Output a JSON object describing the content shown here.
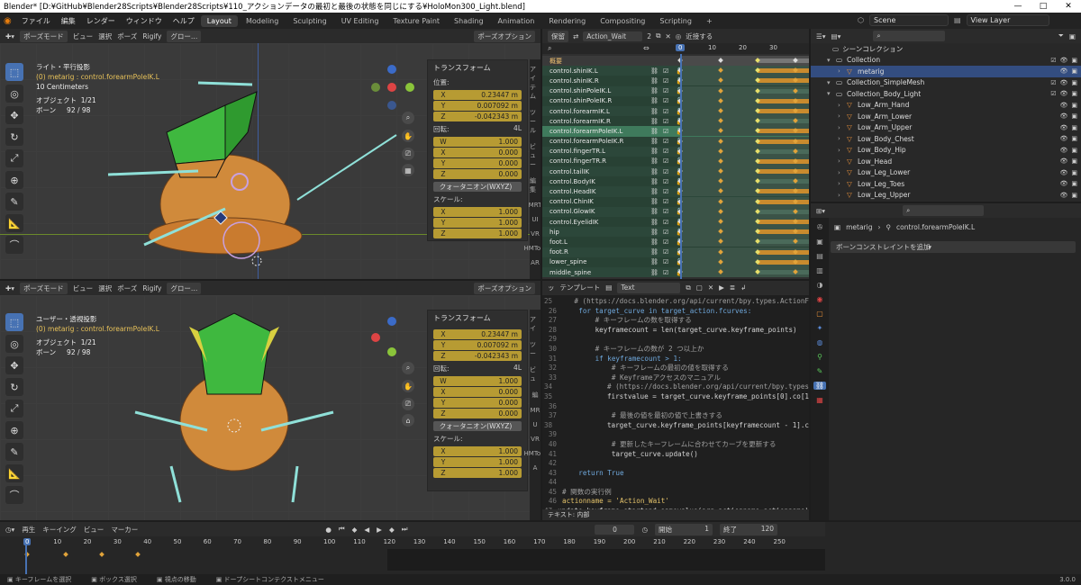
{
  "window": {
    "title": "Blender* [D:¥GitHub¥Blender28Scripts¥Blender28Scripts¥110_アクションデータの最初と最後の状態を同じにする¥HoloMon300_Light.blend]",
    "controls": [
      "—",
      "□",
      "✕"
    ]
  },
  "menu": {
    "items": [
      "ファイル",
      "編集",
      "レンダー",
      "ウィンドウ",
      "ヘルプ"
    ],
    "workspaces": [
      "Layout",
      "Modeling",
      "Sculpting",
      "UV Editing",
      "Texture Paint",
      "Shading",
      "Animation",
      "Rendering",
      "Compositing",
      "Scripting",
      "+"
    ],
    "active_workspace": "Layout",
    "scene": "Scene",
    "view_layer": "View Layer"
  },
  "viewport_top": {
    "header": [
      "ポーズモード",
      "ビュー",
      "選択",
      "ポーズ",
      "Rigify",
      "グロー…"
    ],
    "view_name": "ライト・平行投影",
    "sub": "(0) metarig : control.forearmPoleIK.L",
    "scale": "10 Centimeters",
    "objects_label": "オブジェクト",
    "objects_value": "1/21",
    "bones_label": "ボーン",
    "bones_value": "92 / 98",
    "options": "ポーズオプション"
  },
  "viewport_bottom": {
    "header": [
      "ポーズモード",
      "ビュー",
      "選択",
      "ポーズ",
      "Rigify",
      "グロー…"
    ],
    "view_name": "ユーザー・透視投影",
    "sub": "(0) metarig : control.forearmPoleIK.L",
    "objects_label": "オブジェクト",
    "objects_value": "1/21",
    "bones_label": "ボーン",
    "bones_value": "92 / 98",
    "options": "ポーズオプション"
  },
  "transform": {
    "title": "トランスフォーム",
    "location_label": "位置:",
    "location": [
      [
        "X",
        "0.23447 m"
      ],
      [
        "Y",
        "0.007092 m"
      ],
      [
        "Z",
        "-0.042343 m"
      ]
    ],
    "rotation_label": "回転:",
    "rotation_mode_badge": "4L",
    "rotation": [
      [
        "W",
        "1.000"
      ],
      [
        "X",
        "0.000"
      ],
      [
        "Y",
        "0.000"
      ],
      [
        "Z",
        "0.000"
      ]
    ],
    "rotation_mode": "クォータニオン(WXYZ)",
    "scale_label": "スケール:",
    "scale": [
      [
        "X",
        "1.000"
      ],
      [
        "Y",
        "1.000"
      ],
      [
        "Z",
        "1.000"
      ]
    ]
  },
  "npanel_tabs": [
    "アイテム",
    "ツール",
    "ビュー",
    "編集",
    "MRT",
    "UI",
    "VR",
    "HMTool",
    "AR"
  ],
  "npanel_tabs_bottom": [
    "アイ",
    "ツー",
    "ビュ",
    "編",
    "MR",
    "U",
    "VR",
    "HMTool",
    "A"
  ],
  "dopesheet": {
    "mode": "保留",
    "action": "Action_Wait",
    "users": "2",
    "near": "近接する",
    "frames": [
      "0",
      "10",
      "20",
      "30"
    ],
    "summary": "概要",
    "channels": [
      "control.shinIK.L",
      "control.shinIK.R",
      "control.shinPoleIK.L",
      "control.shinPoleIK.R",
      "control.forearmIK.L",
      "control.forearmIK.R",
      "control.forearmPoleIK.L",
      "control.forearmPoleIK.R",
      "control.fingerTR.L",
      "control.fingerTR.R",
      "control.tailIK",
      "control.BodyIK",
      "control.HeadIK",
      "control.ChinIK",
      "control.GlowIK",
      "control.EyelidIK",
      "hip",
      "foot.L",
      "foot.R",
      "lower_spine",
      "middle_spine"
    ],
    "selected_channel": "control.forearmPoleIK.L",
    "keyframe_frames": [
      0,
      13,
      25,
      37
    ]
  },
  "text_editor": {
    "header": [
      "ッ",
      "テンプレート",
      "Text"
    ],
    "footer": "テキスト: 内部",
    "lines": [
      {
        "n": "25",
        "t": "    # (https://docs.blender.org/api/current/bpy.types.ActionF"
      },
      {
        "n": "26",
        "t": "    for target_curve in target_action.fcurves:"
      },
      {
        "n": "27",
        "t": "        # キーフレームの数を取得する"
      },
      {
        "n": "28",
        "t": "        keyframecount = len(target_curve.keyframe_points)"
      },
      {
        "n": "29",
        "t": ""
      },
      {
        "n": "30",
        "t": "        # キーフレームの数が 2 つ以上か"
      },
      {
        "n": "31",
        "t": "        if keyframecount > 1:"
      },
      {
        "n": "32",
        "t": "            # キーフレームの最初の値を取得する"
      },
      {
        "n": "33",
        "t": "            # Keyframeアクセスのマニュアル"
      },
      {
        "n": "34",
        "t": "            # (https://docs.blender.org/api/current/bpy.types"
      },
      {
        "n": "35",
        "t": "            firstvalue = target_curve.keyframe_points[0].co[1"
      },
      {
        "n": "36",
        "t": ""
      },
      {
        "n": "37",
        "t": "            # 最後の値を最初の値で上書きする"
      },
      {
        "n": "38",
        "t": "            target_curve.keyframe_points[keyframecount - 1].c"
      },
      {
        "n": "39",
        "t": ""
      },
      {
        "n": "40",
        "t": "            # 更新したキーフレームに合わせてカーブを更新する"
      },
      {
        "n": "41",
        "t": "            target_curve.update()"
      },
      {
        "n": "42",
        "t": ""
      },
      {
        "n": "43",
        "t": "    return True"
      },
      {
        "n": "44",
        "t": ""
      },
      {
        "n": "45",
        "t": "# 関数の実行例"
      },
      {
        "n": "46",
        "t": "actionname = 'Action_Wait'"
      },
      {
        "n": "47",
        "t": "update_keyframe_startend_samevalue(arg_actionname=actionname)"
      },
      {
        "n": "48",
        "t": ""
      },
      {
        "n": "49",
        "t": ""
      }
    ]
  },
  "outliner": {
    "title": "シーンコレクション",
    "rows": [
      {
        "name": "Collection",
        "indent": 1
      },
      {
        "name": "metarig",
        "indent": 2,
        "selected": true
      },
      {
        "name": "Collection_SimpleMesh",
        "indent": 1
      },
      {
        "name": "Collection_Body_Light",
        "indent": 1
      },
      {
        "name": "Low_Arm_Hand",
        "indent": 2
      },
      {
        "name": "Low_Arm_Lower",
        "indent": 2
      },
      {
        "name": "Low_Arm_Upper",
        "indent": 2
      },
      {
        "name": "Low_Body_Chest",
        "indent": 2
      },
      {
        "name": "Low_Body_Hip",
        "indent": 2
      },
      {
        "name": "Low_Head",
        "indent": 2
      },
      {
        "name": "Low_Leg_Lower",
        "indent": 2
      },
      {
        "name": "Low_Leg_Toes",
        "indent": 2
      },
      {
        "name": "Low_Leg_Upper",
        "indent": 2
      }
    ]
  },
  "properties": {
    "object": "metarig",
    "bone": "control.forearmPoleIK.L",
    "add_constraint": "ボーンコンストレイントを追加"
  },
  "timeline": {
    "menu": [
      "再生",
      "キーイング",
      "ビュー",
      "マーカー"
    ],
    "current_frame": "0",
    "start_label": "開始",
    "start": "1",
    "end_label": "終了",
    "end": "120",
    "ticks": [
      "0",
      "10",
      "20",
      "30",
      "40",
      "50",
      "60",
      "70",
      "80",
      "90",
      "100",
      "110",
      "120",
      "130",
      "140",
      "150",
      "160",
      "170",
      "180",
      "190",
      "200",
      "210",
      "220",
      "230",
      "240",
      "250"
    ],
    "keyframes": [
      0,
      13,
      25,
      37
    ]
  },
  "status": {
    "items": [
      "キーフレームを選択",
      "ボックス選択",
      "視点の移動",
      "ドープシートコンテクストメニュー"
    ],
    "version": "3.0.0"
  },
  "colors": {
    "accent": "#4772b3",
    "field": "#b79b33",
    "keyframe": "#e0a33a",
    "green_bone": "#3fb83f"
  }
}
